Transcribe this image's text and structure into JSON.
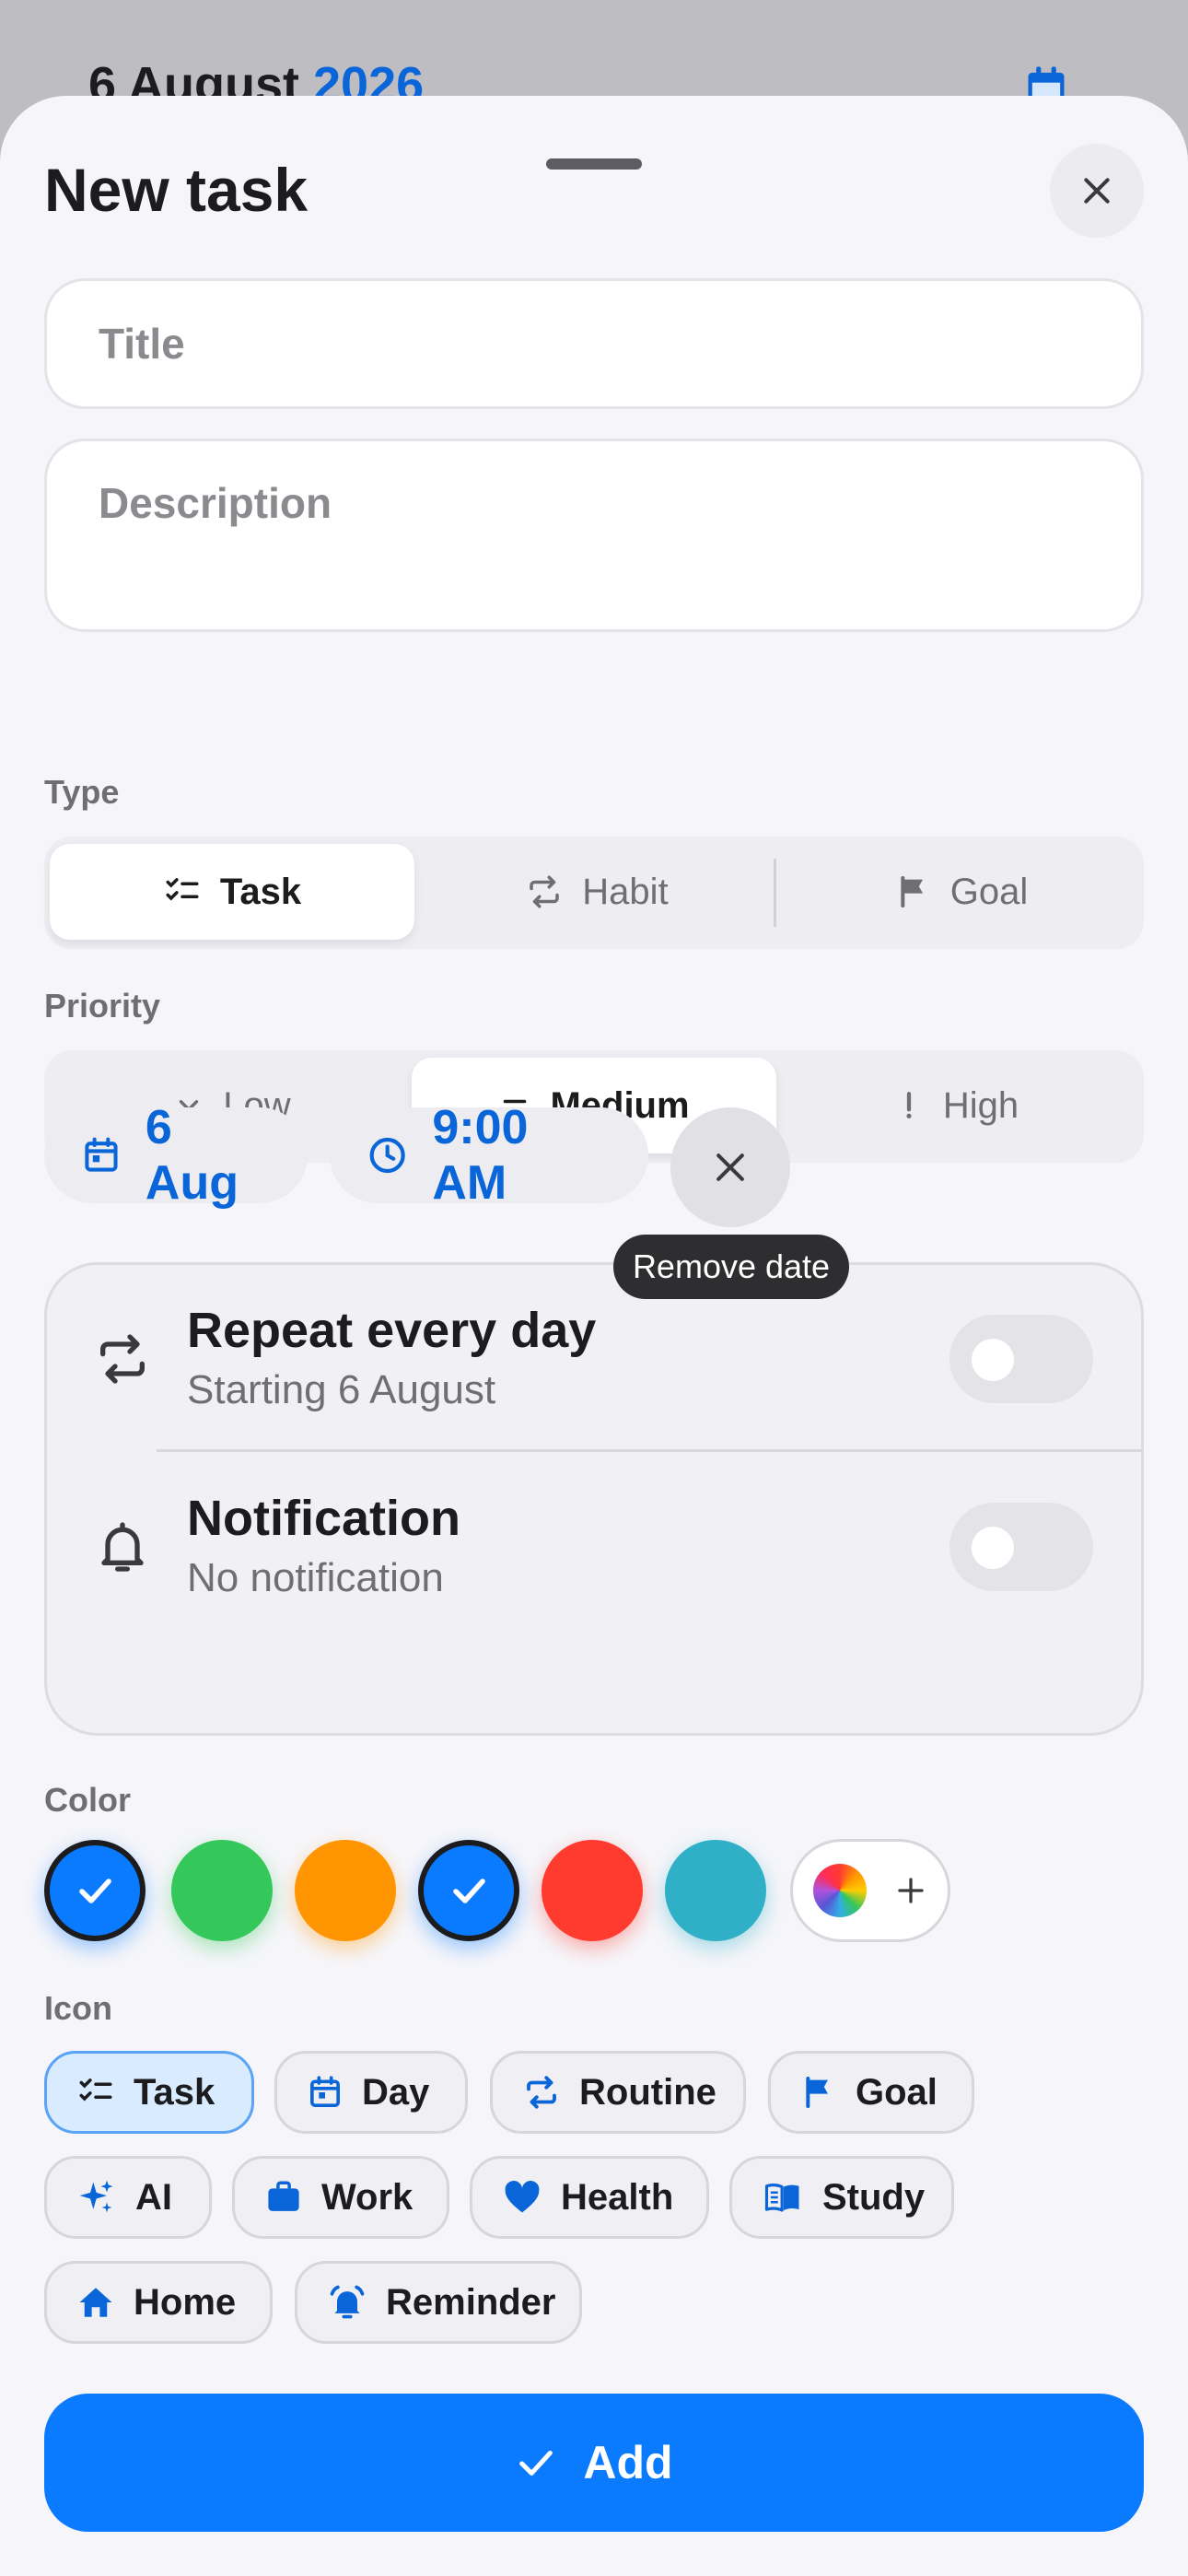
{
  "backdrop": {
    "date_day_month": "6 August",
    "date_year": "2026"
  },
  "sheet": {
    "title": "New task",
    "title_placeholder": "Title",
    "description_placeholder": "Description"
  },
  "type": {
    "label": "Type",
    "options": [
      {
        "label": "Task",
        "icon": "checklist-icon",
        "selected": true
      },
      {
        "label": "Habit",
        "icon": "repeat-icon",
        "selected": false
      },
      {
        "label": "Goal",
        "icon": "flag-icon",
        "selected": false
      }
    ]
  },
  "priority": {
    "label": "Priority",
    "options": [
      {
        "label": "Low",
        "icon": "chevron-down-icon",
        "selected": false
      },
      {
        "label": "Medium",
        "icon": "equals-icon",
        "selected": true
      },
      {
        "label": "High",
        "icon": "exclamation-icon",
        "selected": false
      }
    ]
  },
  "schedule": {
    "date": "6 Aug",
    "time": "9:00 AM",
    "remove_tooltip": "Remove date"
  },
  "options": {
    "repeat_title": "Repeat every day",
    "repeat_sub": "Starting 6 August",
    "repeat_on": false,
    "notification_title": "Notification",
    "notification_sub": "No notification",
    "notification_on": false
  },
  "color": {
    "label": "Color",
    "swatches": [
      {
        "hex": "#0A7AFF",
        "selected": true
      },
      {
        "hex": "#34C759",
        "selected": false
      },
      {
        "hex": "#FF9500",
        "selected": false
      },
      {
        "hex": "#0A7AFF",
        "selected": true
      },
      {
        "hex": "#FF3B30",
        "selected": false
      },
      {
        "hex": "#30B0C7",
        "selected": false
      }
    ]
  },
  "icon": {
    "label": "Icon",
    "chips": [
      {
        "label": "Task",
        "icon": "checklist-icon",
        "selected": true
      },
      {
        "label": "Day",
        "icon": "calendar-icon",
        "selected": false
      },
      {
        "label": "Routine",
        "icon": "repeat-icon",
        "selected": false
      },
      {
        "label": "Goal",
        "icon": "flag-icon",
        "selected": false
      },
      {
        "label": "AI",
        "icon": "sparkles-icon",
        "selected": false
      },
      {
        "label": "Work",
        "icon": "briefcase-icon",
        "selected": false
      },
      {
        "label": "Health",
        "icon": "heart-icon",
        "selected": false
      },
      {
        "label": "Study",
        "icon": "book-icon",
        "selected": false
      },
      {
        "label": "Home",
        "icon": "home-icon",
        "selected": false
      },
      {
        "label": "Reminder",
        "icon": "alarm-icon",
        "selected": false
      }
    ]
  },
  "add_label": "Add",
  "colors": {
    "accent": "#0A7AFF",
    "accent_text": "#0A66D8"
  }
}
